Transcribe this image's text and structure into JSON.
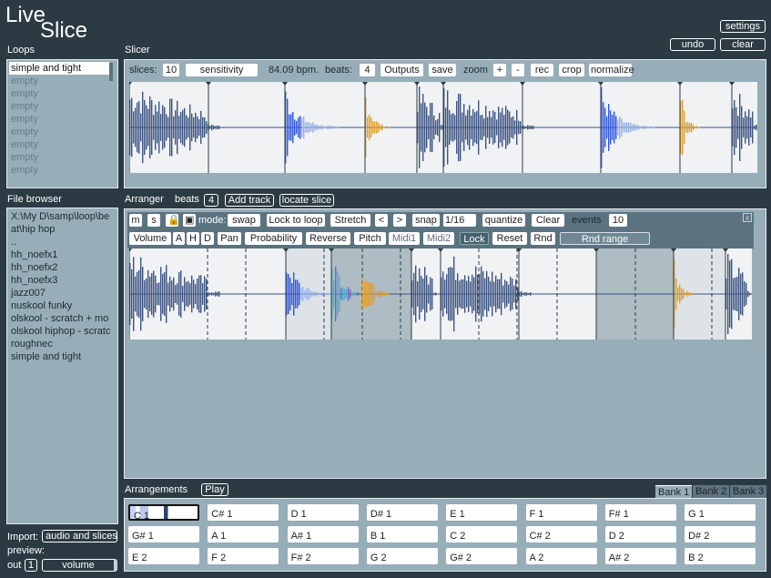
{
  "app": {
    "logo_top": "Live",
    "logo_bottom": "Slice"
  },
  "header": {
    "settings": "settings",
    "undo": "undo",
    "clear": "clear"
  },
  "loops": {
    "title": "Loops",
    "items": [
      "simple and tight",
      "empty",
      "empty",
      "empty",
      "empty",
      "empty",
      "empty",
      "empty",
      "empty"
    ]
  },
  "slicer": {
    "title": "Slicer",
    "slices_label": "slices:",
    "slices": "10",
    "sensitivity": "sensitivity",
    "bpm": "84.09 bpm.",
    "beats_label": "beats:",
    "beats": "4",
    "outputs": "Outputs",
    "save": "save",
    "zoom": "zoom",
    "zoom_in": "+",
    "zoom_out": "-",
    "rec": "rec",
    "crop": "crop",
    "normalize": "normalize"
  },
  "file_browser": {
    "title": "File browser",
    "items": [
      "X:\\My D\\samp\\loop\\be",
      "at\\hip hop",
      "..",
      "hh_noefx1",
      "hh_noefx2",
      "hh_noefx3",
      "jazz007",
      "nuskool funky",
      "olskool - scratch + mo",
      "olskool hiphop - scratc",
      "roughnec",
      "simple and tight"
    ]
  },
  "arranger": {
    "title": "Arranger",
    "beats_label": "beats",
    "beats": "4",
    "add_track": "Add track",
    "locate_slice": "locate slice",
    "row1": {
      "m": "m",
      "s": "s",
      "mode_label": "mode:",
      "mode": "swap",
      "lock_to_loop": "Lock to loop",
      "stretch": "Stretch",
      "prev": "<",
      "next": ">",
      "snap": "snap",
      "snap_value": "1/16",
      "quantize": "quantize",
      "clear": "Clear",
      "events_label": "events",
      "events": "10",
      "close": "x"
    },
    "row2": {
      "volume": "Volume",
      "a": "A",
      "h": "H",
      "d": "D",
      "pan": "Pan",
      "probability": "Probability",
      "reverse": "Reverse",
      "pitch": "Pitch",
      "midi1": "Midi1",
      "midi2": "Midi2",
      "lock": "Lock",
      "reset": "Reset",
      "rnd": "Rnd",
      "rnd_range": "Rnd range"
    }
  },
  "arrangements": {
    "title": "Arrangements",
    "play": "Play",
    "banks": [
      "Bank 1",
      "Bank 2",
      "Bank 3"
    ],
    "active_bank": "Bank 1",
    "slots": [
      "C 1",
      "C# 1",
      "D 1",
      "D# 1",
      "E 1",
      "F 1",
      "F# 1",
      "G 1",
      "G# 1",
      "A 1",
      "A# 1",
      "B 1",
      "C 2",
      "C# 2",
      "D 2",
      "D# 2",
      "E 2",
      "F 2",
      "F# 2",
      "G 2",
      "G# 2",
      "A 2",
      "A# 2",
      "B 2"
    ],
    "selected_slot": "C 1"
  },
  "footer": {
    "import_label": "Import:",
    "import_mode": "audio and slices",
    "preview_label": "preview:",
    "out_label": "out",
    "out": "1",
    "volume": "volume"
  },
  "colors": {
    "background": "#2c3b43",
    "panel": "#97adb8",
    "wave": "#3d5482",
    "wave_accent": "#2f55e0",
    "wave_orange": "#e0a030"
  }
}
